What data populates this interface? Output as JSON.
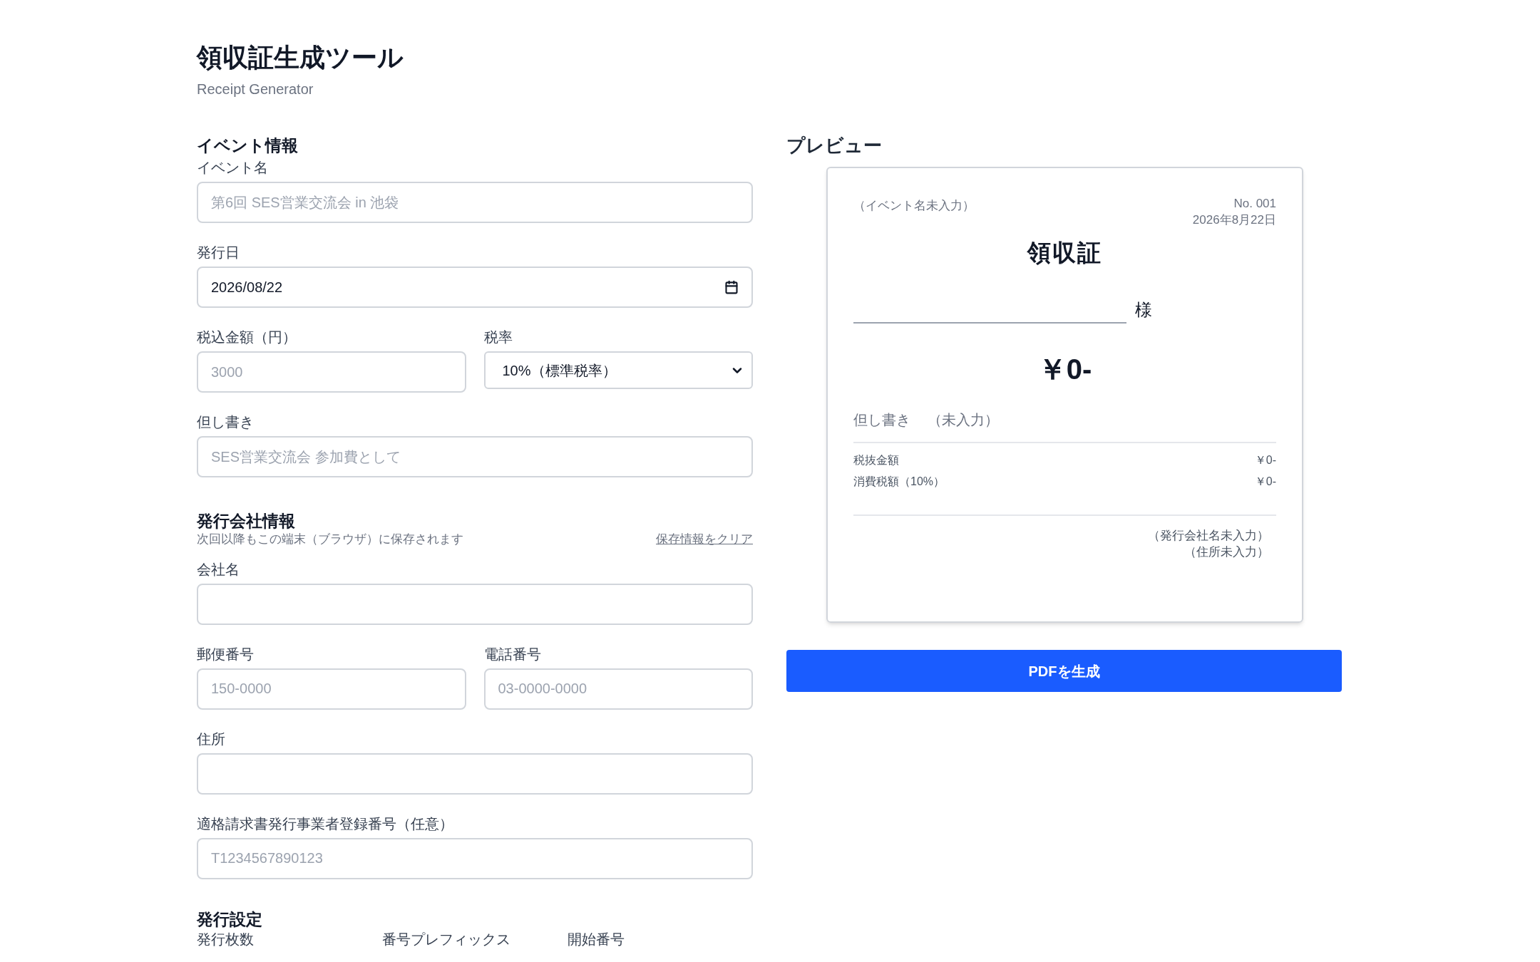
{
  "header": {
    "title": "領収証生成ツール",
    "subtitle": "Receipt Generator"
  },
  "event_section": {
    "heading": "イベント情報",
    "rows": [
      [
        {
          "kind": "text",
          "label": "イベント名",
          "placeholder": "第6回 SES営業交流会 in 池袋"
        }
      ],
      [
        {
          "kind": "date",
          "label": "発行日",
          "value": "2026/08/22"
        }
      ],
      [
        {
          "kind": "text",
          "label": "税込金額（円）",
          "placeholder": "3000"
        },
        {
          "kind": "select",
          "label": "税率",
          "value": "10%（標準税率）"
        }
      ],
      [
        {
          "kind": "text",
          "label": "但し書き",
          "placeholder": "SES営業交流会 参加費として"
        }
      ]
    ]
  },
  "company_section": {
    "heading": "発行会社情報",
    "note": "次回以降もこの端末（ブラウザ）に保存されます",
    "clear_link": "保存情報をクリア",
    "rows": [
      [
        {
          "kind": "text",
          "label": "会社名"
        }
      ],
      [
        {
          "kind": "text",
          "label": "郵便番号",
          "placeholder": "150-0000"
        },
        {
          "kind": "text",
          "label": "電話番号",
          "placeholder": "03-0000-0000"
        }
      ],
      [
        {
          "kind": "text",
          "label": "住所"
        }
      ],
      [
        {
          "kind": "text",
          "label": "適格請求書発行事業者登録番号（任意）",
          "placeholder": "T1234567890123"
        }
      ]
    ]
  },
  "issue_section": {
    "heading": "発行設定",
    "labels": [
      "発行枚数",
      "番号プレフィックス",
      "開始番号"
    ]
  },
  "preview": {
    "heading": "プレビュー",
    "event_name": "（イベント名未入力）",
    "number": "No. 001",
    "date": "2026年8月22日",
    "title": "領収証",
    "honorific": "様",
    "amount": "￥0-",
    "memo_label": "但し書き",
    "memo_value": "（未入力）",
    "lines": [
      {
        "label": "税抜金額",
        "value": "￥0-"
      },
      {
        "label": "消費税額（10%）",
        "value": "￥0-"
      }
    ],
    "issuer": [
      "（発行会社名未入力）",
      "（住所未入力）"
    ]
  },
  "generate_button": "PDFを生成"
}
